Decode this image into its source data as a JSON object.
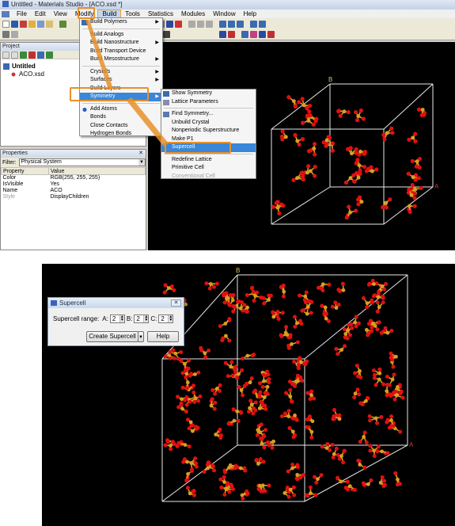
{
  "window": {
    "title": "Untitled - Materials Studio - [ACO.xsd *]"
  },
  "menubar": {
    "items": [
      "File",
      "Edit",
      "View",
      "Modify",
      "Build",
      "Tools",
      "Statistics",
      "Modules",
      "Window",
      "Help"
    ],
    "active": "Build"
  },
  "project_panel": {
    "title": "Project",
    "root": "Untitled",
    "file": "ACO.xsd"
  },
  "properties_panel": {
    "title": "Properties",
    "filter_label": "Filter:",
    "filter_value": "Physical System",
    "headers": [
      "Property",
      "Value"
    ],
    "rows": [
      {
        "property": "Color",
        "value": "RGB(255, 255, 255)"
      },
      {
        "property": "IsVisible",
        "value": "Yes"
      },
      {
        "property": "Name",
        "value": "ACO"
      },
      {
        "property": "Style",
        "value": "DisplayChildren"
      }
    ]
  },
  "build_menu": {
    "items": [
      "Build Polymers",
      "Build Analogs",
      "Build Nanostructure",
      "Build Transport Device",
      "Build Mesostructure",
      "Crystals",
      "Surfaces",
      "Build Layers",
      "Symmetry",
      "Add Atoms",
      "Bonds",
      "Close Contacts",
      "Hydrogen Bonds"
    ],
    "highlighted": "Symmetry"
  },
  "symmetry_menu": {
    "items": [
      "Show Symmetry",
      "Lattice Parameters",
      "Find Symmetry...",
      "Unbuild Crystal",
      "Nonperiodic Superstructure",
      "Make P1",
      "Supercell",
      "Redefine Lattice",
      "Primitive Cell",
      "Conventional Cell"
    ],
    "highlighted": "Supercell",
    "disabled": [
      "Conventional Cell"
    ]
  },
  "axes": {
    "a": "A",
    "b": "B"
  },
  "supercell_dialog": {
    "title": "Supercell",
    "range_label": "Supercell range:",
    "a_label": "A:",
    "a_value": "2",
    "b_label": "B:",
    "b_value": "2",
    "c_label": "C:",
    "c_value": "2",
    "create_button": "Create Supercell",
    "help_button": "Help"
  },
  "colors": {
    "oxygen": "#e01010",
    "metal": "#d8a020",
    "cell_line": "#e8e8e8",
    "highlight": "#3a86d8",
    "callout": "#e8902a"
  }
}
